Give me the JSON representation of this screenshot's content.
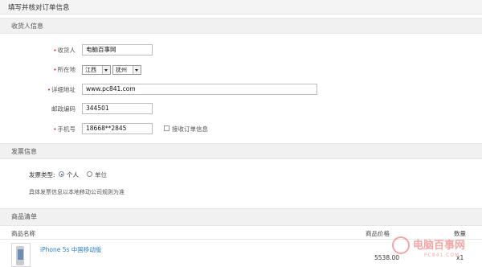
{
  "page": {
    "title": "填写并核对订单信息"
  },
  "receiver": {
    "section_title": "收货人信息",
    "name_label": "收货人",
    "name_value": "电脑百事网",
    "location_label": "所在地",
    "province": "江西",
    "city": "抚州",
    "address_label": "详细地址",
    "address_value": "www.pc841.com",
    "zip_label": "邮政编码",
    "zip_value": "344501",
    "phone_label": "手机号",
    "phone_value": "18668**2845",
    "sms_option": "接收订单信息"
  },
  "invoice": {
    "section_title": "发票信息",
    "type_label": "发票类型:",
    "option_personal": "个人",
    "option_company": "单位",
    "note": "具体发票信息以本地移动公司规则为准"
  },
  "products": {
    "section_title": "商品清单",
    "col_name": "商品名称",
    "col_price": "商品价格",
    "col_qty": "数量",
    "items": [
      {
        "name": "iPhone 5s 中国移动版",
        "price": "5538.00",
        "qty": "x1"
      }
    ]
  },
  "watermark": {
    "text": "电脑百事网",
    "url": "PC841.COM"
  }
}
